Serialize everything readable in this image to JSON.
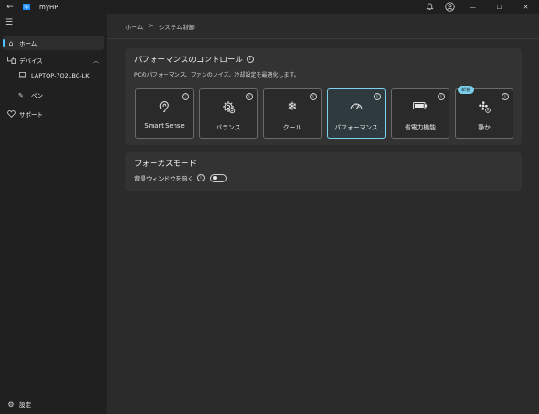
{
  "app": {
    "title": "myHP",
    "logo_text": "hp"
  },
  "titlebar": {
    "back_icon": "arrow-left-icon",
    "bell_icon": "bell-icon",
    "account_icon": "account-icon",
    "minimize": "—",
    "maximize": "☐",
    "close": "✕"
  },
  "sidebar": {
    "items": [
      {
        "label": "ホーム",
        "icon": "home-icon"
      },
      {
        "label": "デバイス",
        "icon": "devices-icon"
      },
      {
        "label": "サポート",
        "icon": "support-icon"
      }
    ],
    "devices": [
      {
        "label": "LAPTOP-7O2LBC-LK",
        "icon": "laptop-icon"
      },
      {
        "label": "ペン",
        "icon": "pen-icon"
      }
    ],
    "settings": {
      "label": "設定",
      "icon": "gear-icon"
    }
  },
  "breadcrumb": {
    "home": "ホーム",
    "separator": ">",
    "current": "システム制御"
  },
  "performance": {
    "title": "パフォーマンスのコントロール",
    "description": "PCのパフォーマンス、ファンのノイズ、冷却設定を最適化します。",
    "selected": "パフォーマンス",
    "modes": [
      {
        "label": "Smart Sense",
        "icon": "smart-sense-icon",
        "glyph": "☊"
      },
      {
        "label": "バランス",
        "icon": "balance-gear-icon",
        "glyph": "⚙"
      },
      {
        "label": "クール",
        "icon": "snowflake-icon",
        "glyph": "❄"
      },
      {
        "label": "パフォーマンス",
        "icon": "speedometer-icon",
        "glyph": "◠"
      },
      {
        "label": "省電力機能",
        "icon": "battery-icon",
        "glyph": "▭"
      },
      {
        "label": "静か",
        "icon": "quiet-fan-icon",
        "glyph": "✿",
        "badge": "新着"
      }
    ]
  },
  "focus": {
    "title": "フォーカスモード",
    "option_label": "背景ウィンドウを暗く",
    "toggle_on": false
  },
  "colors": {
    "accent": "#4cc2ff",
    "selected_border": "#7fd0ee",
    "badge": "#7ccfea"
  }
}
